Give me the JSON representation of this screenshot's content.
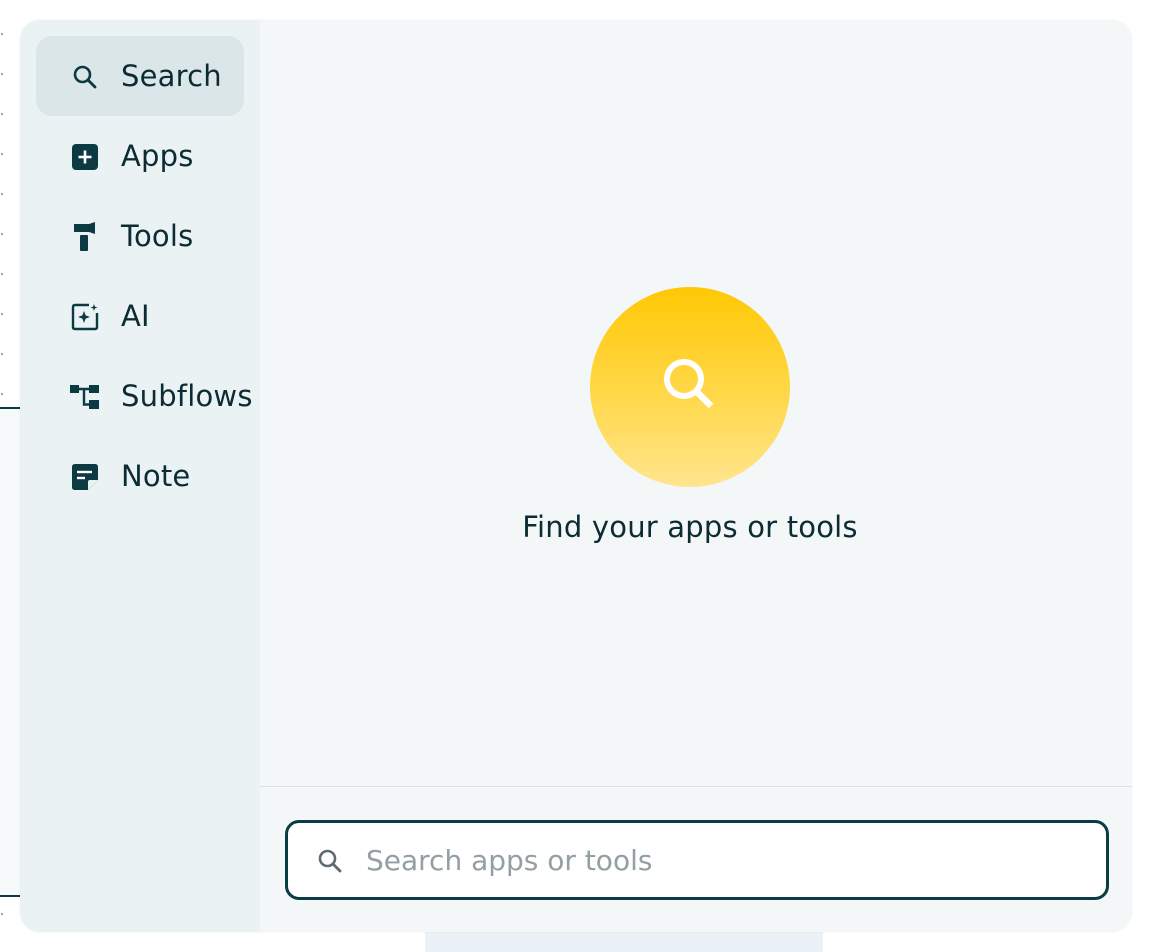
{
  "sidebar": {
    "items": [
      {
        "label": "Search",
        "icon": "search-icon",
        "active": true
      },
      {
        "label": "Apps",
        "icon": "plus-box-icon",
        "active": false
      },
      {
        "label": "Tools",
        "icon": "hammer-icon",
        "active": false
      },
      {
        "label": "AI",
        "icon": "ai-sparkle-icon",
        "active": false
      },
      {
        "label": "Subflows",
        "icon": "subflows-icon",
        "active": false
      },
      {
        "label": "Note",
        "icon": "note-icon",
        "active": false
      }
    ]
  },
  "main": {
    "hero_icon": "search-icon",
    "hero_text": "Find your apps or tools"
  },
  "search": {
    "placeholder": "Search apps or tools",
    "value": ""
  },
  "colors": {
    "accent_dark": "#0b3b44",
    "hero_yellow": "#ffc805",
    "sidebar_bg": "#eaf2f4",
    "active_item_bg": "#dbe6e9"
  }
}
